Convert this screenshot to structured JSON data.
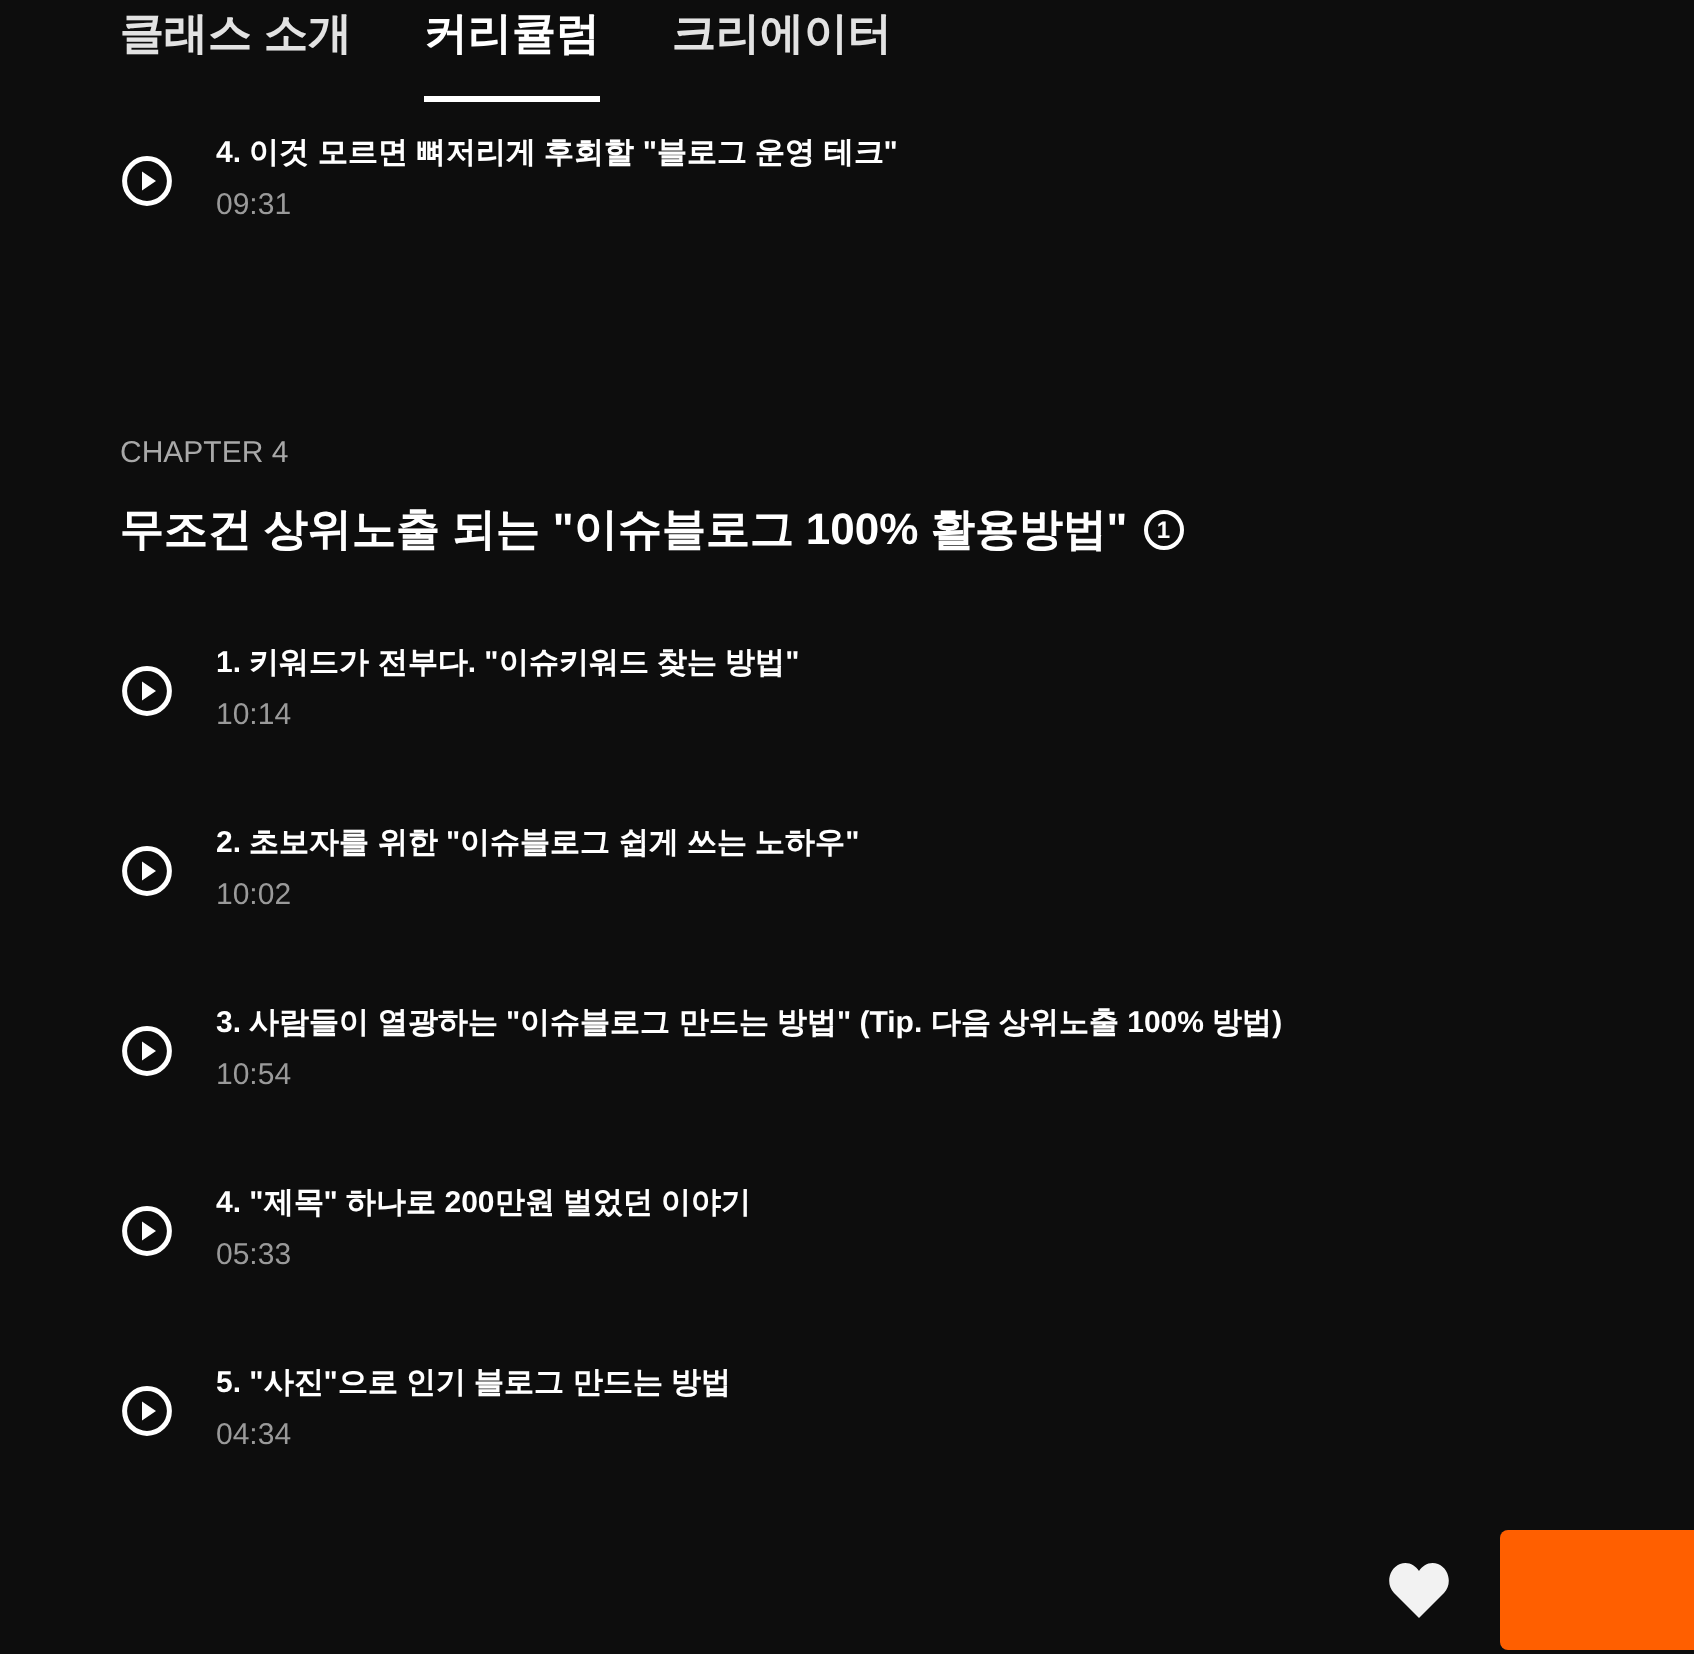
{
  "tabs": [
    {
      "label": "클래스 소개",
      "selected": false
    },
    {
      "label": "커리큘럼",
      "selected": true
    },
    {
      "label": "크리에이터",
      "selected": false
    }
  ],
  "previous_lessons": [
    {
      "title": "4. 이것 모르면 뼈저리게 후회할 \"블로그 운영 테크\"",
      "duration": "09:31"
    }
  ],
  "chapter": {
    "label": "CHAPTER 4",
    "title": "무조건 상위노출 되는 \"이슈블로그 100% 활용방법\"",
    "badge": "1",
    "lessons": [
      {
        "title": "1. 키워드가 전부다. \"이슈키워드 찾는 방법\"",
        "duration": "10:14"
      },
      {
        "title": "2. 초보자를 위한 \"이슈블로그 쉽게 쓰는 노하우\"",
        "duration": "10:02"
      },
      {
        "title": "3. 사람들이 열광하는 \"이슈블로그 만드는 방법\" (Tip. 다음 상위노출 100% 방법)",
        "duration": "10:54"
      },
      {
        "title": "4. \"제목\" 하나로 200만원 벌었던 이야기",
        "duration": "05:33"
      },
      {
        "title": "5. \"사진\"으로 인기 블로그 만드는 방법",
        "duration": "04:34"
      }
    ]
  }
}
